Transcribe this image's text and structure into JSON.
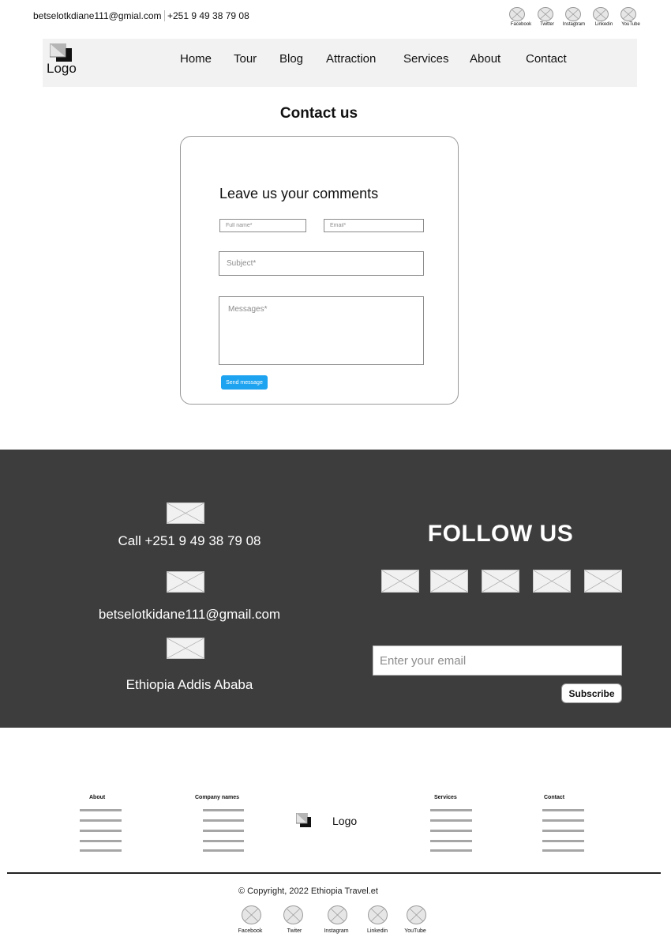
{
  "topbar": {
    "email": "betselotkdiane111@gmial.com",
    "phone": "+251 9 49 38 79 08",
    "social": [
      "Facebook",
      "Twitter",
      "Instagtram",
      "Linkedin",
      "YouTube"
    ]
  },
  "nav": {
    "logo_text": "Logo",
    "items": [
      "Home",
      "Tour",
      "Blog",
      "Attraction",
      "Services",
      "About",
      "Contact"
    ]
  },
  "contact": {
    "page_title": "Contact us",
    "form_title": "Leave us your comments",
    "fullname_placeholder": "Full name*",
    "email_placeholder": "Email*",
    "subject_placeholder": "Subject*",
    "message_placeholder": "Messages*",
    "send_label": "Send message"
  },
  "band": {
    "call_text": "Call +251 9 49 38 79 08",
    "email_text": "betselotkidane111@gmail.com",
    "location_text": "Ethiopia Addis Ababa",
    "follow_title": "FOLLOW US",
    "subscribe_placeholder": "Enter your email",
    "subscribe_label": "Subscribe"
  },
  "footer": {
    "about_heading": "About",
    "company_heading": "Company names",
    "logo_text": "Logo",
    "services_heading": "Services",
    "contact_heading": "Contact",
    "copyright": "© Copyright, 2022 Ethiopia Travel.et",
    "social": [
      "Facebook",
      "Twiter",
      "Instagram",
      "Linkedin",
      "YouTube"
    ]
  },
  "colors": {
    "accent": "#1ea3f0",
    "band_background": "#3d3d3d",
    "nav_background": "#f2f2f2"
  }
}
